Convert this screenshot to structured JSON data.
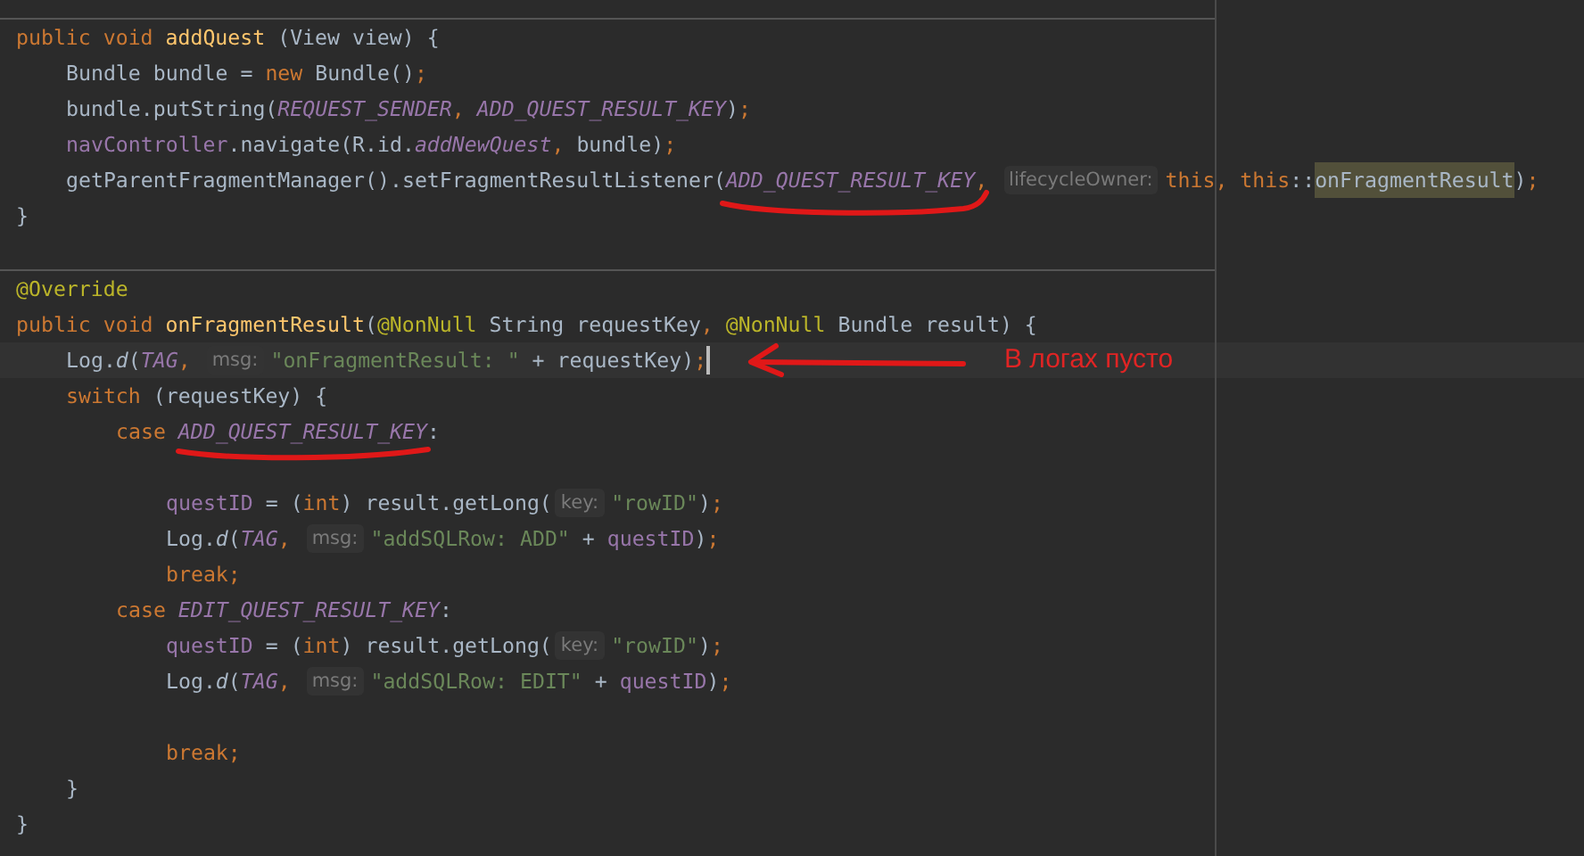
{
  "methods": [
    {
      "lines": [
        {
          "kind": "code",
          "caret": false,
          "tokens": [
            {
              "t": "public void ",
              "kind": "keyword"
            },
            {
              "t": "addQuest",
              "kind": "function"
            },
            {
              "t": " (View view) {",
              "kind": "plain"
            }
          ],
          "children": [
            {
              "kind": "code",
              "caret": false,
              "tokens": [
                {
                  "t": "Bundle bundle = ",
                  "kind": "plain"
                },
                {
                  "t": "new",
                  "kind": "keyword"
                },
                {
                  "t": " Bundle()",
                  "kind": "plain"
                },
                {
                  "t": ";",
                  "kind": "keyword"
                }
              ]
            },
            {
              "kind": "code",
              "caret": false,
              "tokens": [
                {
                  "t": "bundle.putString(",
                  "kind": "plain"
                },
                {
                  "t": "REQUEST_SENDER",
                  "kind": "constant"
                },
                {
                  "t": ", ",
                  "kind": "keyword"
                },
                {
                  "t": "ADD_QUEST_RESULT_KEY",
                  "kind": "constant"
                },
                {
                  "t": ")",
                  "kind": "plain"
                },
                {
                  "t": ";",
                  "kind": "keyword"
                }
              ]
            },
            {
              "kind": "code",
              "caret": false,
              "tokens": [
                {
                  "t": "navController",
                  "kind": "field"
                },
                {
                  "t": ".navigate(R.id.",
                  "kind": "plain"
                },
                {
                  "t": "addNewQuest",
                  "kind": "constant"
                },
                {
                  "t": ", ",
                  "kind": "keyword"
                },
                {
                  "t": "bundle)",
                  "kind": "plain"
                },
                {
                  "t": ";",
                  "kind": "keyword"
                }
              ]
            },
            {
              "kind": "code",
              "caret": false,
              "tokens": [
                {
                  "t": "getParentFragmentManager().setFragmentResultListener(",
                  "kind": "plain"
                },
                {
                  "t": "ADD_QUEST_RESULT_KEY",
                  "kind": "constant"
                },
                {
                  "t": ", ",
                  "kind": "keyword"
                },
                {
                  "t": "lifecycleOwner:",
                  "kind": "hint"
                },
                {
                  "t": "this, this",
                  "kind": "keyword"
                },
                {
                  "t": "::",
                  "kind": "plain"
                },
                {
                  "t": "onFragmentResult",
                  "kind": "highlight"
                },
                {
                  "t": ")",
                  "kind": "plain"
                },
                {
                  "t": ";",
                  "kind": "keyword"
                }
              ]
            }
          ]
        },
        {
          "kind": "code",
          "caret": false,
          "tokens": [
            {
              "t": "}",
              "kind": "plain"
            }
          ]
        },
        {
          "kind": "blank"
        }
      ]
    },
    {
      "lines": [
        {
          "kind": "code",
          "caret": false,
          "tokens": [
            {
              "t": "@Override",
              "kind": "annotation"
            }
          ]
        },
        {
          "kind": "code",
          "caret": false,
          "tokens": [
            {
              "t": "public void ",
              "kind": "keyword"
            },
            {
              "t": "onFragmentResult",
              "kind": "function"
            },
            {
              "t": "(",
              "kind": "plain"
            },
            {
              "t": "@NonNull",
              "kind": "annotation"
            },
            {
              "t": " String requestKey",
              "kind": "plain"
            },
            {
              "t": ", ",
              "kind": "keyword"
            },
            {
              "t": "@NonNull",
              "kind": "annotation"
            },
            {
              "t": " Bundle result) {",
              "kind": "plain"
            }
          ],
          "children": [
            {
              "kind": "code",
              "caret": true,
              "tokens": [
                {
                  "t": "Log.",
                  "kind": "plain"
                },
                {
                  "t": "d",
                  "kind": "italic"
                },
                {
                  "t": "(",
                  "kind": "plain"
                },
                {
                  "t": "TAG",
                  "kind": "constant"
                },
                {
                  "t": ", ",
                  "kind": "keyword"
                },
                {
                  "t": "msg:",
                  "kind": "hint"
                },
                {
                  "t": "\"onFragmentResult: \"",
                  "kind": "string"
                },
                {
                  "t": " + requestKey)",
                  "kind": "plain"
                },
                {
                  "t": ";",
                  "kind": "keyword"
                }
              ]
            },
            {
              "kind": "code",
              "caret": false,
              "tokens": [
                {
                  "t": "switch",
                  "kind": "keyword"
                },
                {
                  "t": " (requestKey) {",
                  "kind": "plain"
                }
              ],
              "children": [
                {
                  "kind": "code",
                  "caret": false,
                  "tokens": [
                    {
                      "t": "case ",
                      "kind": "keyword"
                    },
                    {
                      "t": "ADD_QUEST_RESULT_KEY",
                      "kind": "constant"
                    },
                    {
                      "t": ":",
                      "kind": "plain"
                    }
                  ],
                  "children": [
                    {
                      "kind": "blank"
                    },
                    {
                      "kind": "code",
                      "caret": false,
                      "tokens": [
                        {
                          "t": "questID",
                          "kind": "field"
                        },
                        {
                          "t": " = (",
                          "kind": "plain"
                        },
                        {
                          "t": "int",
                          "kind": "keyword"
                        },
                        {
                          "t": ") result.getLong(",
                          "kind": "plain"
                        },
                        {
                          "t": "key:",
                          "kind": "hint"
                        },
                        {
                          "t": "\"rowID\"",
                          "kind": "string"
                        },
                        {
                          "t": ")",
                          "kind": "plain"
                        },
                        {
                          "t": ";",
                          "kind": "keyword"
                        }
                      ]
                    },
                    {
                      "kind": "code",
                      "caret": false,
                      "tokens": [
                        {
                          "t": "Log.",
                          "kind": "plain"
                        },
                        {
                          "t": "d",
                          "kind": "italic"
                        },
                        {
                          "t": "(",
                          "kind": "plain"
                        },
                        {
                          "t": "TAG",
                          "kind": "constant"
                        },
                        {
                          "t": ", ",
                          "kind": "keyword"
                        },
                        {
                          "t": "msg:",
                          "kind": "hint"
                        },
                        {
                          "t": "\"addSQLRow: ADD\"",
                          "kind": "string"
                        },
                        {
                          "t": " + ",
                          "kind": "plain"
                        },
                        {
                          "t": "questID",
                          "kind": "field"
                        },
                        {
                          "t": ")",
                          "kind": "plain"
                        },
                        {
                          "t": ";",
                          "kind": "keyword"
                        }
                      ]
                    },
                    {
                      "kind": "code",
                      "caret": false,
                      "tokens": [
                        {
                          "t": "break;",
                          "kind": "keyword"
                        }
                      ]
                    }
                  ]
                },
                {
                  "kind": "code",
                  "caret": false,
                  "tokens": [
                    {
                      "t": "case ",
                      "kind": "keyword"
                    },
                    {
                      "t": "EDIT_QUEST_RESULT_KEY",
                      "kind": "constant"
                    },
                    {
                      "t": ":",
                      "kind": "plain"
                    }
                  ],
                  "children": [
                    {
                      "kind": "code",
                      "caret": false,
                      "tokens": [
                        {
                          "t": "questID",
                          "kind": "field"
                        },
                        {
                          "t": " = (",
                          "kind": "plain"
                        },
                        {
                          "t": "int",
                          "kind": "keyword"
                        },
                        {
                          "t": ") result.getLong(",
                          "kind": "plain"
                        },
                        {
                          "t": "key:",
                          "kind": "hint"
                        },
                        {
                          "t": "\"rowID\"",
                          "kind": "string"
                        },
                        {
                          "t": ")",
                          "kind": "plain"
                        },
                        {
                          "t": ";",
                          "kind": "keyword"
                        }
                      ]
                    },
                    {
                      "kind": "code",
                      "caret": false,
                      "tokens": [
                        {
                          "t": "Log.",
                          "kind": "plain"
                        },
                        {
                          "t": "d",
                          "kind": "italic"
                        },
                        {
                          "t": "(",
                          "kind": "plain"
                        },
                        {
                          "t": "TAG",
                          "kind": "constant"
                        },
                        {
                          "t": ", ",
                          "kind": "keyword"
                        },
                        {
                          "t": "msg:",
                          "kind": "hint"
                        },
                        {
                          "t": "\"addSQLRow: EDIT\"",
                          "kind": "string"
                        },
                        {
                          "t": " + ",
                          "kind": "plain"
                        },
                        {
                          "t": "questID",
                          "kind": "field"
                        },
                        {
                          "t": ")",
                          "kind": "plain"
                        },
                        {
                          "t": ";",
                          "kind": "keyword"
                        }
                      ]
                    },
                    {
                      "kind": "blank"
                    },
                    {
                      "kind": "code",
                      "caret": false,
                      "tokens": [
                        {
                          "t": "break;",
                          "kind": "keyword"
                        }
                      ]
                    }
                  ]
                }
              ]
            },
            {
              "kind": "code",
              "caret": false,
              "tokens": [
                {
                  "t": "}",
                  "kind": "plain"
                }
              ]
            }
          ]
        },
        {
          "kind": "code",
          "caret": false,
          "tokens": [
            {
              "t": "}",
              "kind": "plain"
            }
          ]
        }
      ]
    }
  ],
  "annotation": {
    "text": "В логах пусто"
  }
}
